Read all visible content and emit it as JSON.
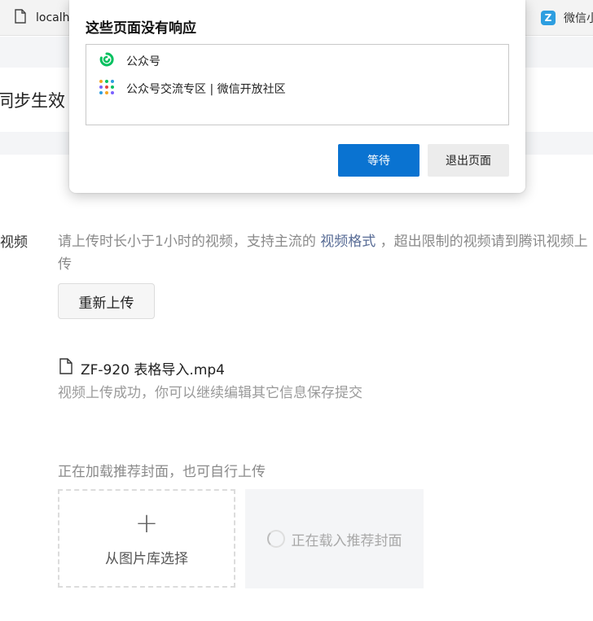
{
  "browser": {
    "tab_left_title": "localh",
    "tab_right_title": "微信小"
  },
  "page": {
    "heading": "同步生效（",
    "video_field_label": "视频",
    "upload_hint_part1": "请上传时长小于1小时的视频，支持主流的",
    "upload_hint_link": "视频格式",
    "upload_hint_part2": "，超出限制的视频请到腾讯视频上",
    "upload_hint_cont": "传",
    "reupload_label": "重新上传",
    "file_name": "ZF-920 表格导入.mp4",
    "upload_success_text": "视频上传成功，你可以继续编辑其它信息保存提交",
    "cover_hint": "正在加载推荐封面，也可自行上传",
    "cover_select_label": "从图片库选择",
    "cover_loading_label": "正在载入推荐封面"
  },
  "dialog": {
    "title": "这些页面没有响应",
    "pages": [
      "公众号",
      "公众号交流专区 | 微信开放社区"
    ],
    "wait_label": "等待",
    "exit_label": "退出页面"
  },
  "colors": {
    "primary_button": "#0a73d1",
    "link": "#576b95",
    "wechat_green": "#07c160"
  }
}
